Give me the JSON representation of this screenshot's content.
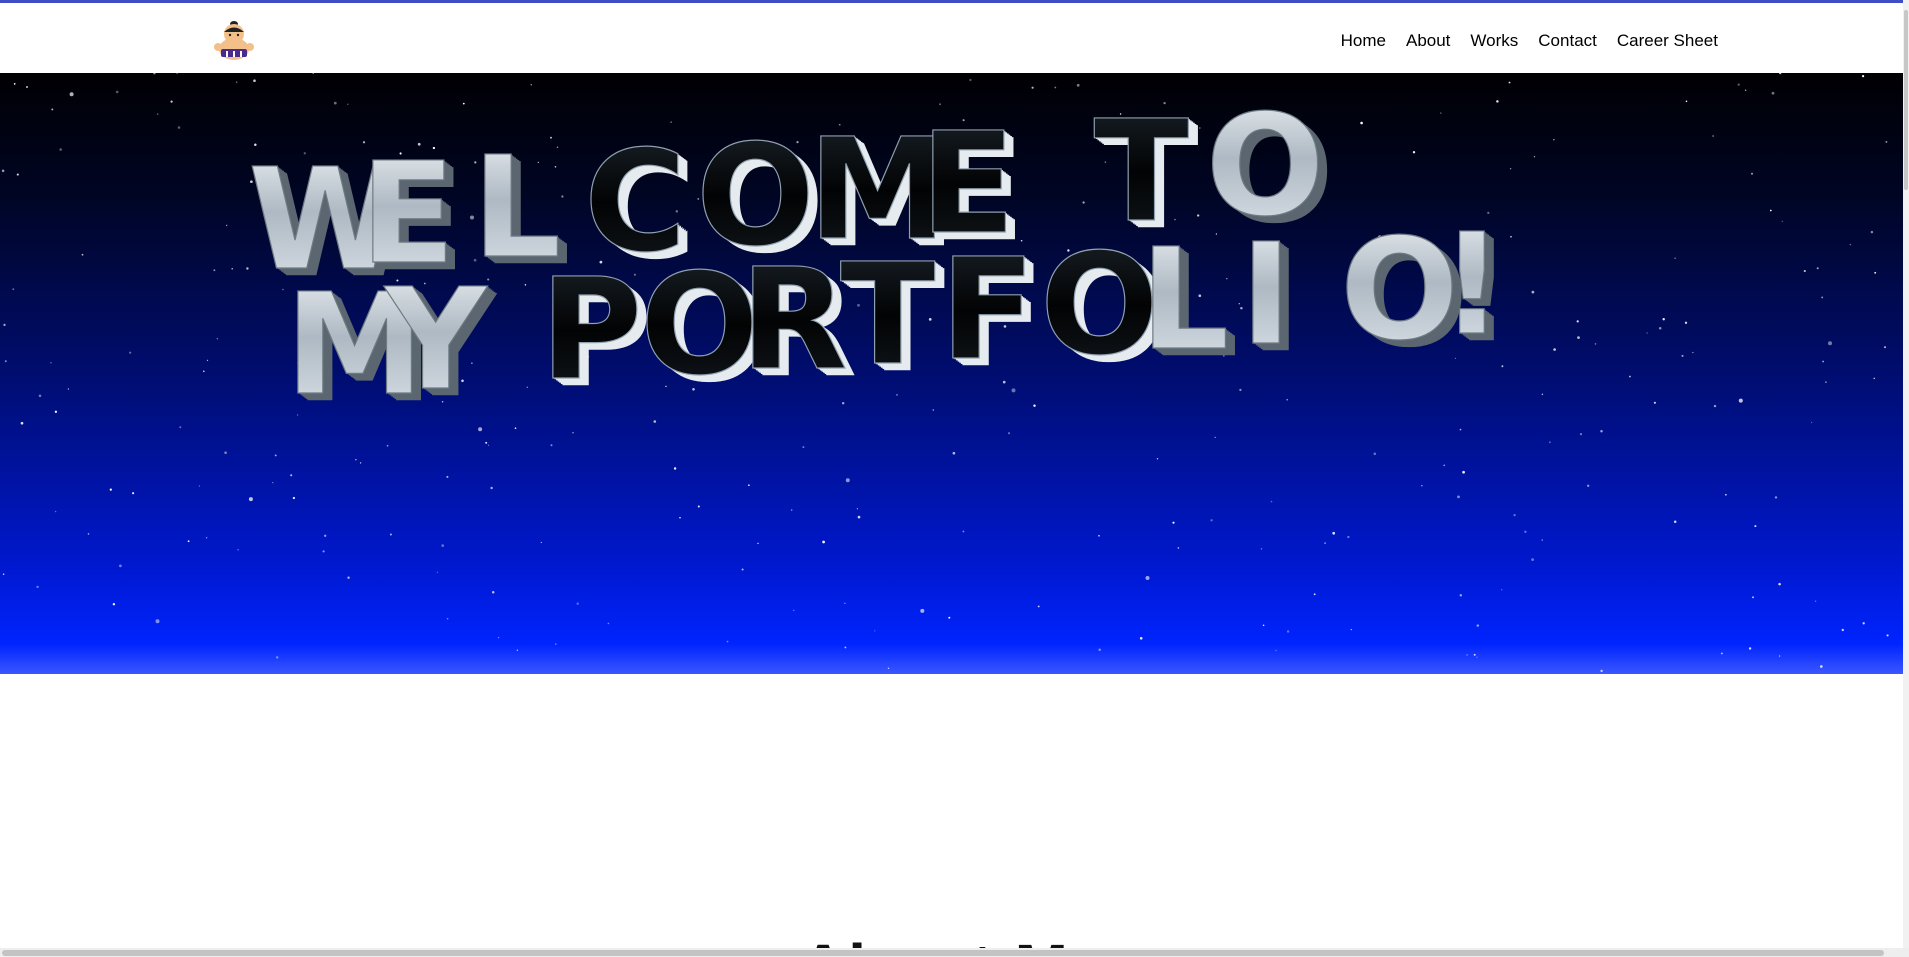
{
  "nav": {
    "logo_icon": "sumo-wrestler-logo-icon",
    "items": [
      {
        "label": "Home"
      },
      {
        "label": "About"
      },
      {
        "label": "Works"
      },
      {
        "label": "Contact"
      },
      {
        "label": "Career Sheet"
      }
    ]
  },
  "hero": {
    "line1": "WELCOME TO",
    "line2": "MY PORTFOLIO!"
  },
  "next_section": {
    "heading_peek": "About Me"
  },
  "colors": {
    "accent_line": "#3f4ec4",
    "hero_top": "#000003",
    "hero_bottom": "#0024ff",
    "letter_silver": "#c9d2da",
    "letter_black": "#05070a"
  }
}
